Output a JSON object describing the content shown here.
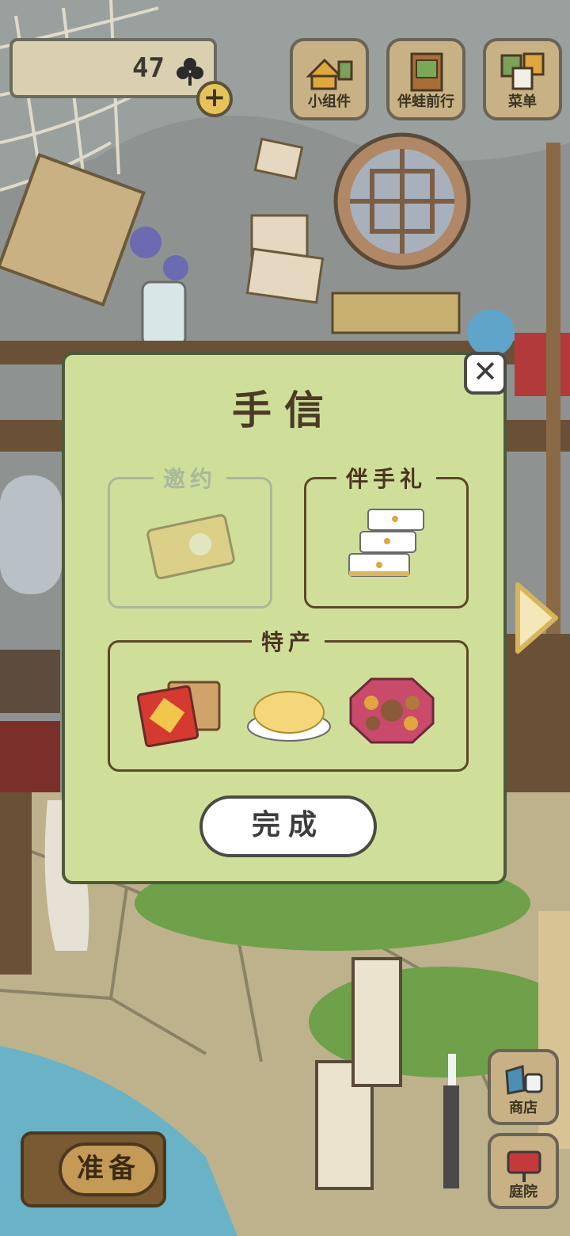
{
  "hud": {
    "clover_count": "47",
    "plus_symbol": "+"
  },
  "top_buttons": [
    {
      "label": "小组件",
      "icon": "widget-icon"
    },
    {
      "label": "伴蛙前行",
      "icon": "frog-book-icon"
    },
    {
      "label": "菜单",
      "icon": "menu-cards-icon"
    }
  ],
  "side_buttons": {
    "shop_label": "商店",
    "yard_label": "庭院"
  },
  "prepare_label": "准备",
  "dialog": {
    "title": "手信",
    "close_symbol": "✕",
    "slots": {
      "invite": "邀约",
      "gift": "伴手礼",
      "special": "特产"
    },
    "done_label": "完成"
  },
  "colors": {
    "dialog_bg": "#cfdf9a",
    "button_wood": "#c8b184",
    "dark_border": "#4b4b45"
  }
}
